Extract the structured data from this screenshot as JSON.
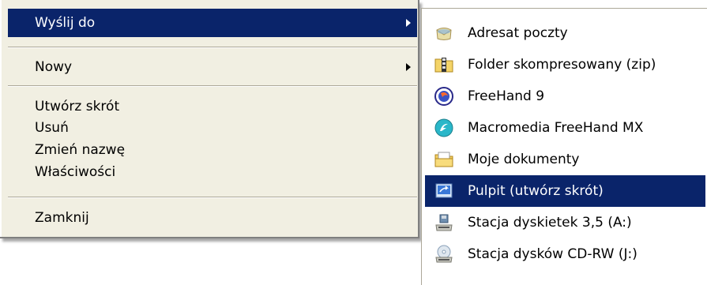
{
  "context_menu": {
    "items": [
      {
        "label": "Wyślij do",
        "has_submenu": true,
        "selected": true
      },
      {
        "label": "Nowy",
        "has_submenu": true,
        "selected": false
      },
      {
        "label": "Utwórz skrót"
      },
      {
        "label": "Usuń"
      },
      {
        "label": "Zmień nazwę"
      },
      {
        "label": "Właściwości"
      },
      {
        "label": "Zamknij"
      }
    ]
  },
  "send_to_submenu": {
    "items": [
      {
        "label": "Adresat poczty",
        "icon": "mail-recipient-icon"
      },
      {
        "label": "Folder skompresowany (zip)",
        "icon": "zip-folder-icon"
      },
      {
        "label": "FreeHand 9",
        "icon": "freehand9-icon"
      },
      {
        "label": "Macromedia FreeHand MX",
        "icon": "freehand-mx-icon"
      },
      {
        "label": "Moje dokumenty",
        "icon": "my-documents-icon"
      },
      {
        "label": "Pulpit (utwórz skrót)",
        "icon": "desktop-shortcut-icon",
        "selected": true
      },
      {
        "label": "Stacja dyskietek 3,5 (A:)",
        "icon": "floppy-drive-icon"
      },
      {
        "label": "Stacja dysków CD-RW (J:)",
        "icon": "cdrw-drive-icon"
      }
    ]
  },
  "colors": {
    "menu_background": "#f1efe2",
    "selection": "#0a246a",
    "submenu_background": "#ffffff"
  }
}
